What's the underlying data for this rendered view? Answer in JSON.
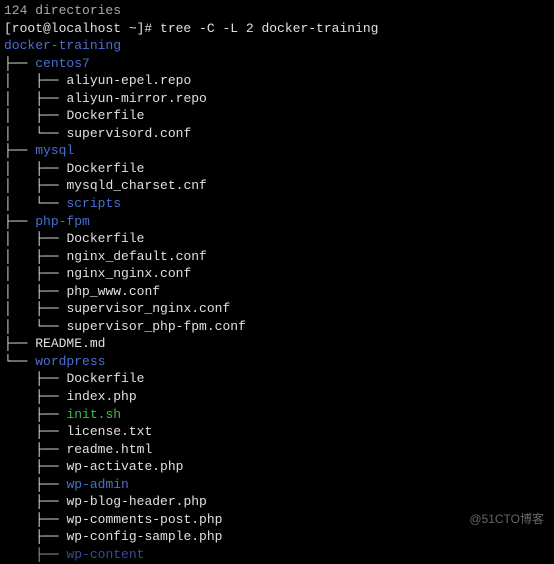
{
  "truncated_top": "124 directories",
  "prompt": "[root@localhost ~]# ",
  "command": "tree -C -L 2 docker-training",
  "root_dir": "docker-training",
  "tree": {
    "centos7": {
      "type": "dir",
      "children": [
        {
          "name": "aliyun-epel.repo",
          "type": "file"
        },
        {
          "name": "aliyun-mirror.repo",
          "type": "file"
        },
        {
          "name": "Dockerfile",
          "type": "file"
        },
        {
          "name": "supervisord.conf",
          "type": "file",
          "last": true
        }
      ]
    },
    "mysql": {
      "type": "dir",
      "children": [
        {
          "name": "Dockerfile",
          "type": "file"
        },
        {
          "name": "mysqld_charset.cnf",
          "type": "file"
        },
        {
          "name": "scripts",
          "type": "dir",
          "last": true
        }
      ]
    },
    "php_fpm": {
      "label": "php-fpm",
      "type": "dir",
      "children": [
        {
          "name": "Dockerfile",
          "type": "file"
        },
        {
          "name": "nginx_default.conf",
          "type": "file"
        },
        {
          "name": "nginx_nginx.conf",
          "type": "file"
        },
        {
          "name": "php_www.conf",
          "type": "file"
        },
        {
          "name": "supervisor_nginx.conf",
          "type": "file"
        },
        {
          "name": "supervisor_php-fpm.conf",
          "type": "file",
          "last": true
        }
      ]
    },
    "readme": {
      "label": "README.md",
      "type": "file"
    },
    "wordpress": {
      "type": "dir",
      "last": true,
      "children": [
        {
          "name": "Dockerfile",
          "type": "file"
        },
        {
          "name": "index.php",
          "type": "file"
        },
        {
          "name": "init.sh",
          "type": "exec"
        },
        {
          "name": "license.txt",
          "type": "file"
        },
        {
          "name": "readme.html",
          "type": "file"
        },
        {
          "name": "wp-activate.php",
          "type": "file"
        },
        {
          "name": "wp-admin",
          "type": "dir"
        },
        {
          "name": "wp-blog-header.php",
          "type": "file"
        },
        {
          "name": "wp-comments-post.php",
          "type": "file"
        },
        {
          "name": "wp-config-sample.php",
          "type": "file"
        },
        {
          "name": "wp-content",
          "type": "dir",
          "cutoff": true
        }
      ]
    }
  },
  "branches": {
    "pipe": "│   ",
    "tee": "├── ",
    "elbow": "└── ",
    "space": "    "
  },
  "watermark": "@51CTO博客"
}
